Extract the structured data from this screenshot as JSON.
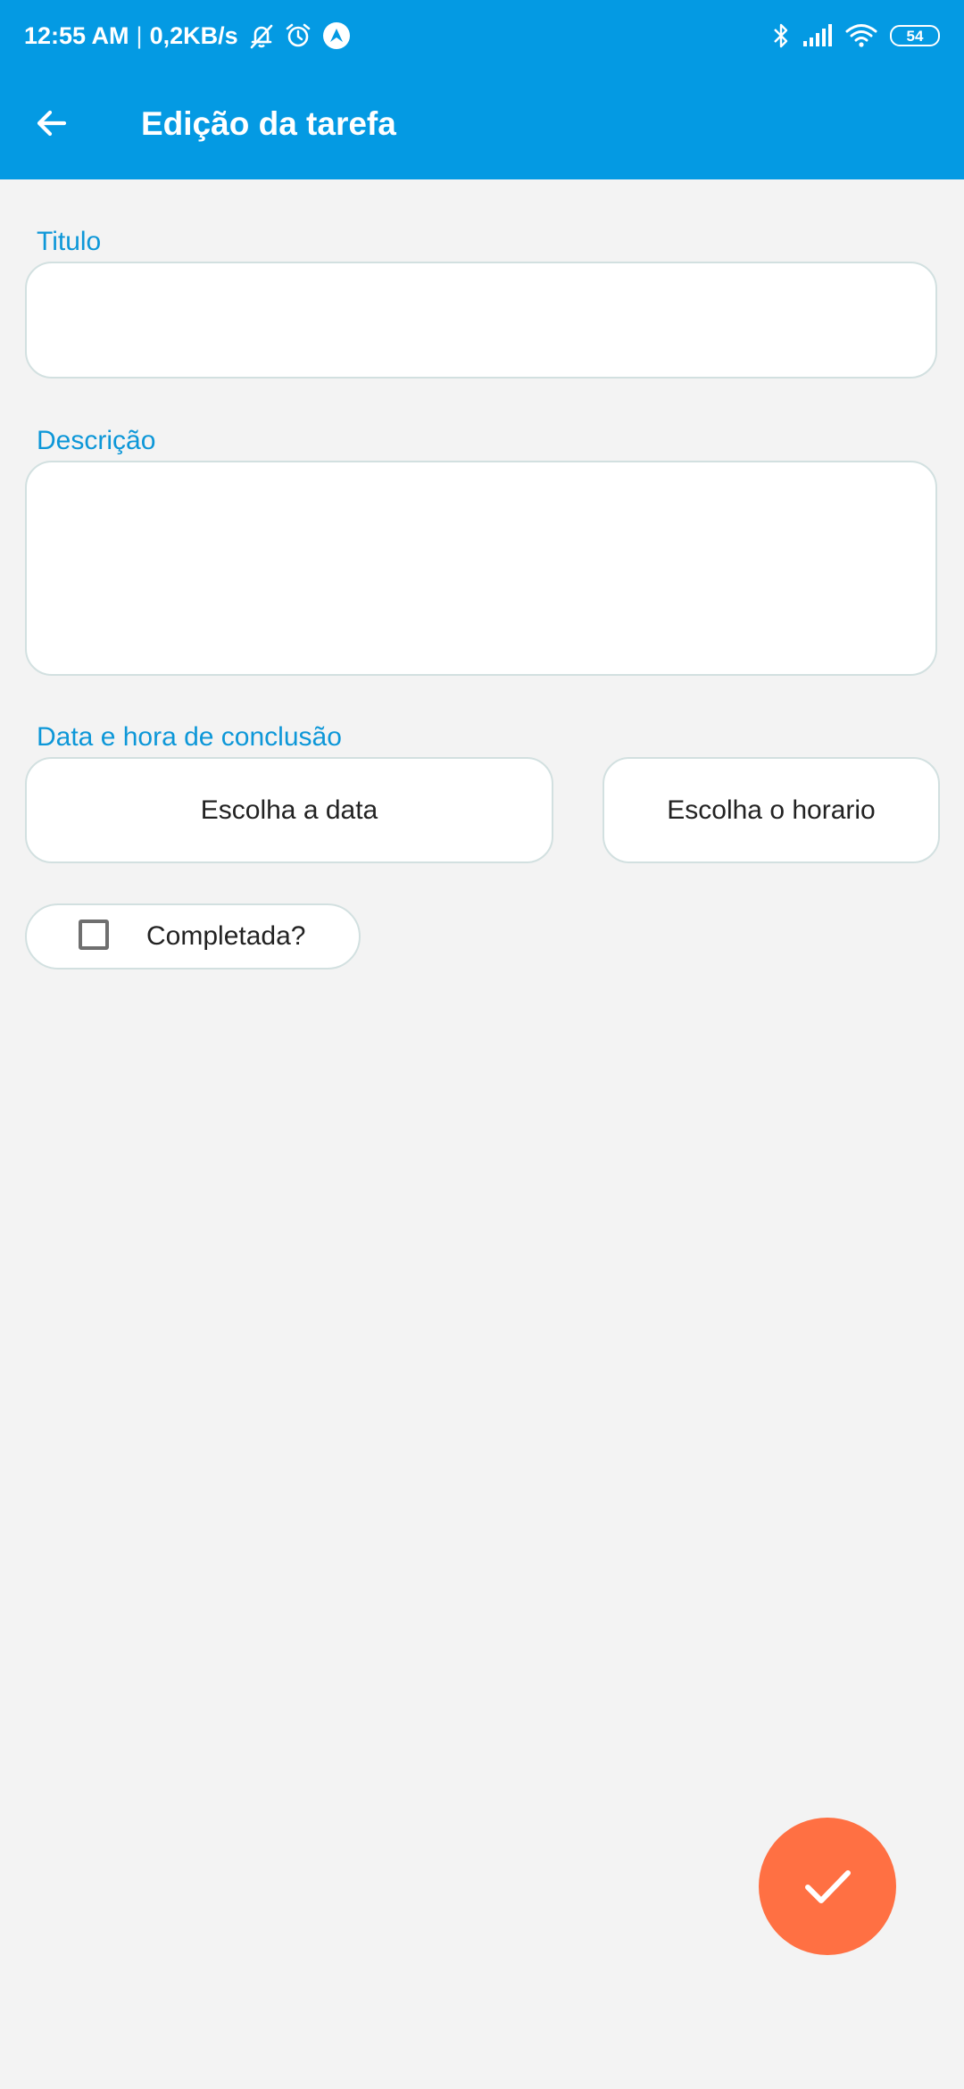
{
  "status_bar": {
    "time": "12:55 AM",
    "separator": "|",
    "net_speed": "0,2KB/s",
    "battery": "54",
    "left_icons": [
      "bell-off-icon",
      "alarm-icon",
      "nav-arrow-icon"
    ],
    "right_icons": [
      "bluetooth-icon",
      "signal-icon",
      "wifi-icon",
      "battery-icon"
    ]
  },
  "app_bar": {
    "title": "Edição da tarefa",
    "back_icon": "arrow-left-icon"
  },
  "form": {
    "title_label": "Titulo",
    "title_value": "",
    "description_label": "Descrição",
    "description_value": "",
    "datetime_label": "Data e hora de conclusão",
    "date_button": "Escolha a data",
    "time_button": "Escolha o horario",
    "completed_label": "Completada?",
    "completed": false
  },
  "fab": {
    "icon": "check-icon"
  },
  "colors": {
    "primary": "#049ae3",
    "label": "#0d97d8",
    "background": "#f3f3f3",
    "field_border": "#d2e0e0",
    "fab": "#ff7043",
    "text": "#222222"
  }
}
